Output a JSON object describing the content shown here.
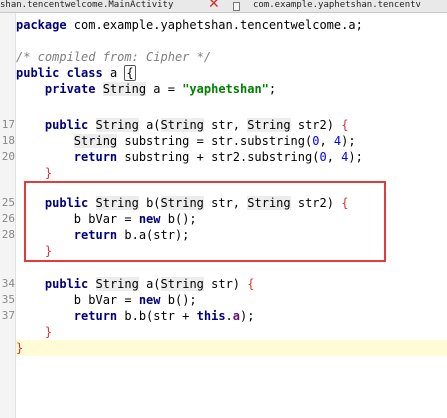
{
  "tabs": [
    {
      "label": "shan.tencentwelcome.MainActivity"
    },
    {
      "label": "com.example.yaphetshan.tencentv"
    }
  ],
  "icons": {
    "close": "close-icon",
    "file": "java-file-icon"
  },
  "code": {
    "package_kw": "package",
    "package_name": " com.example.yaphetshan.tencentwelcome.a;",
    "comment": "/* compiled from: Cipher */",
    "class_decl": {
      "kw1": "public",
      "kw2": "class",
      "name": " a ",
      "brace": "{"
    },
    "field": {
      "kw": "private",
      "type": "String",
      "rest": " a = ",
      "value": "\"yaphetshan\"",
      "end": ";"
    },
    "m1": {
      "sig_kw": "public",
      "sig_type": "String",
      "sig_a": " a(",
      "p1_type": "String",
      "p1": " str, ",
      "p2_type": "String",
      "p2": " str2) ",
      "brace": "{",
      "l1_type": "String",
      "l1": " substring = str.substring(",
      "l1_n1": "0",
      "l1_sep": ", ",
      "l1_n2": "4",
      "l1_end": ");",
      "l2_kw": "return",
      "l2": " substring + str2.substring(",
      "l2_n1": "0",
      "l2_sep": ", ",
      "l2_n2": "4",
      "l2_end": ");",
      "close": "}"
    },
    "m2": {
      "sig_kw": "public",
      "sig_type": "String",
      "sig_b": " b(",
      "p1_type": "String",
      "p1": " str, ",
      "p2_type": "String",
      "p2": " str2) ",
      "brace": "{",
      "l1": "b bVar = ",
      "l1_kw": "new",
      "l1_end": " b();",
      "l2_kw": "return",
      "l2": " b.a(str);",
      "close": "}"
    },
    "m3": {
      "sig_kw": "public",
      "sig_type": "String",
      "sig_a": " a(",
      "p1_type": "String",
      "p1": " str) ",
      "brace": "{",
      "l1": "b bVar = ",
      "l1_kw": "new",
      "l1_end": " b();",
      "l2_kw": "return",
      "l2": " b.b(str + ",
      "l2_this": "this",
      "l2_dot": ".",
      "l2_field": "a",
      "l2_end": ");",
      "close": "}"
    },
    "class_close": "}"
  },
  "line_numbers": [
    "17",
    "18",
    "20",
    "25",
    "26",
    "28",
    "34",
    "35",
    "37"
  ]
}
